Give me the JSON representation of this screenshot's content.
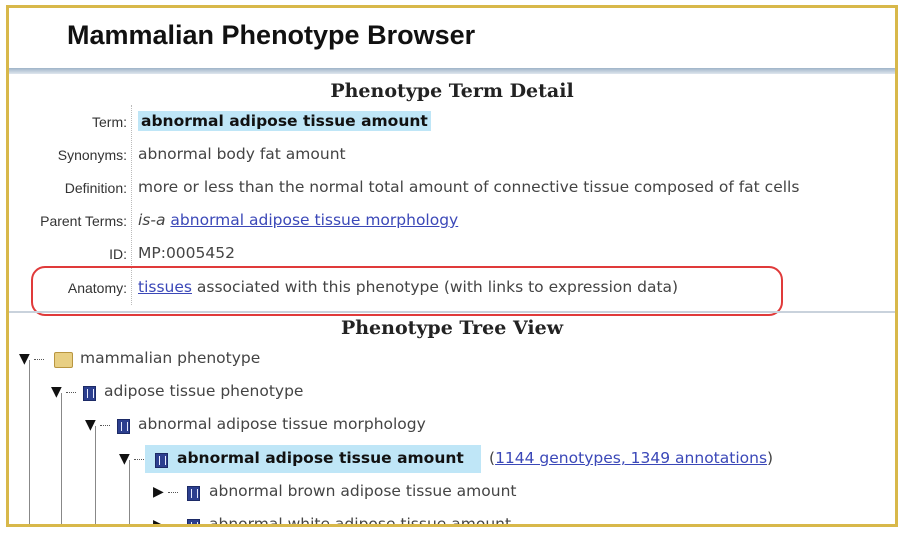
{
  "app": {
    "title": "Mammalian Phenotype Browser"
  },
  "detail": {
    "section_title": "Phenotype Term Detail",
    "term_label": "Term:",
    "term_value": "abnormal adipose tissue amount",
    "synonyms_label": "Synonyms:",
    "synonyms_value": "abnormal body fat amount",
    "definition_label": "Definition:",
    "definition_value": "more or less than the normal total amount of connective tissue composed of fat cells",
    "parent_label": "Parent Terms:",
    "parent_relation": "is-a",
    "parent_link": "abnormal adipose tissue morphology",
    "id_label": "ID:",
    "id_value": "MP:0005452",
    "anatomy_label": "Anatomy:",
    "anatomy_link": "tissues",
    "anatomy_text": " associated with this phenotype (with links to expression data)"
  },
  "tree": {
    "section_title": "Phenotype Tree View",
    "nodes": [
      {
        "label": "mammalian phenotype",
        "icon": "folder-icon"
      },
      {
        "label": "adipose tissue phenotype",
        "icon": "term-icon"
      },
      {
        "label": "abnormal adipose tissue morphology",
        "icon": "term-icon"
      },
      {
        "label": "abnormal adipose tissue amount",
        "icon": "term-icon",
        "current": true,
        "counts_open": "(",
        "counts_link": "1144 genotypes, 1349 annotations",
        "counts_close": ")"
      },
      {
        "label": "abnormal brown adipose tissue amount",
        "icon": "term-icon"
      },
      {
        "label": "abnormal white adipose tissue amount",
        "icon": "term-icon"
      }
    ]
  },
  "colors": {
    "frame_border": "#d8b84a",
    "highlight": "#bfe6f7",
    "link": "#3b48b8",
    "annotation_oval": "#e03a3a"
  }
}
